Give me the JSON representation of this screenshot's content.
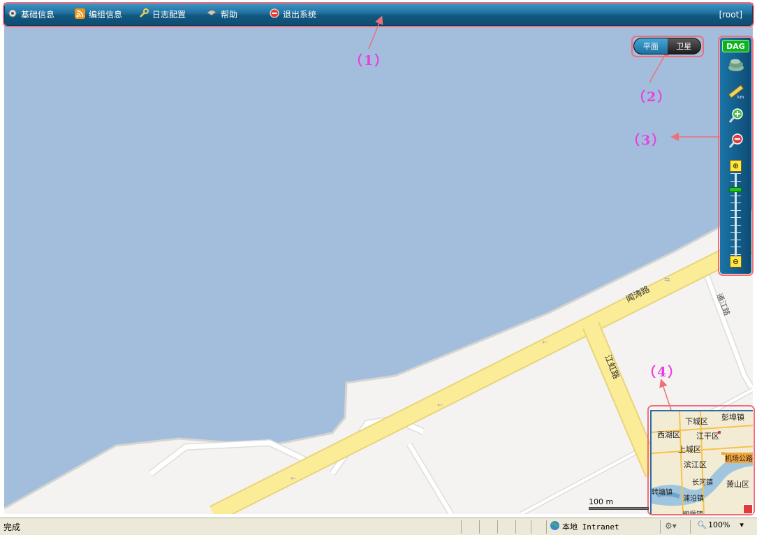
{
  "menu": {
    "items": [
      {
        "label": "基础信息",
        "icon": "gear-icon"
      },
      {
        "label": "编组信息",
        "icon": "rss-icon"
      },
      {
        "label": "日志配置",
        "icon": "wrench-icon"
      },
      {
        "label": "帮助",
        "icon": "help-icon"
      },
      {
        "label": "退出系统",
        "icon": "exit-icon"
      }
    ],
    "user": "[root]"
  },
  "map_type": {
    "options": [
      "平面",
      "卫星"
    ],
    "selected": "平面"
  },
  "toolbar": {
    "badge": "DAG",
    "tools": [
      "layers-icon",
      "ruler-icon",
      "zoom-in-icon",
      "zoom-out-icon"
    ],
    "zoom_level_fraction": 0.18
  },
  "roads": {
    "r1": "闻涛路",
    "r2": "江虹路",
    "r3": "通江路"
  },
  "scale": {
    "label": "100 m"
  },
  "overview": {
    "places": [
      "下城区",
      "彭埠镇",
      "西湖区",
      "江干区",
      "上城区",
      "机场公路",
      "滨江区",
      "长河镇",
      "萧山区",
      "浦沿镇",
      "转塘镇",
      "闻堰镇"
    ]
  },
  "annotations": [
    "（1）",
    "（2）",
    "（3）",
    "（4）"
  ],
  "status": {
    "text": "完成",
    "zone": "本地 Intranet",
    "zoom": "100%"
  },
  "colors": {
    "water": "#a3bedc",
    "land": "#f4f3f1",
    "road": "#fbec98",
    "annotation": "#e83fe0",
    "outline": "#ee6f7b"
  }
}
